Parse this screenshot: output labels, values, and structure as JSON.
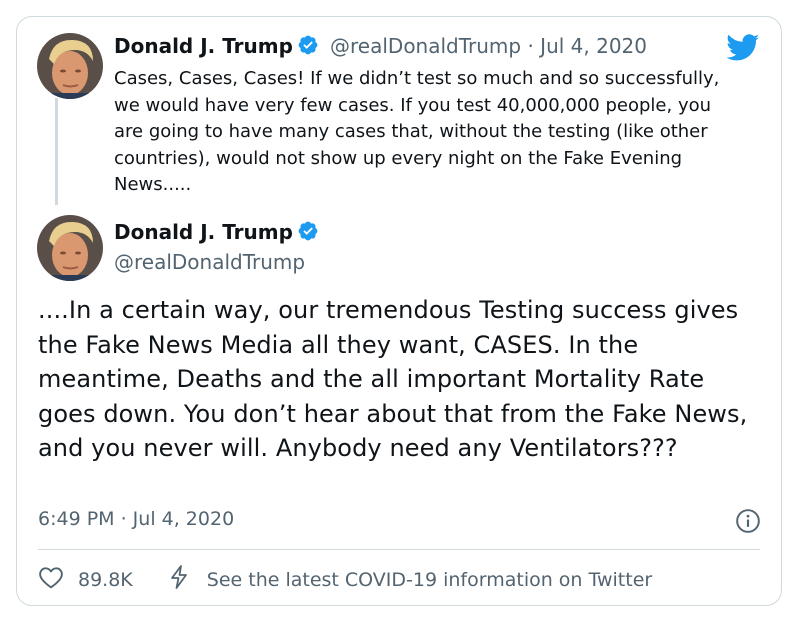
{
  "quoted_tweet": {
    "display_name": "Donald J. Trump",
    "handle": "@realDonaldTrump",
    "separator": " · ",
    "date": "Jul 4, 2020",
    "text": "Cases, Cases, Cases! If we didn’t test so much and so successfully, we would have very few cases. If you test 40,000,000 people, you are going to have many cases that, without the testing (like other countries), would not show up every night on the Fake Evening News....."
  },
  "main_tweet": {
    "display_name": "Donald J. Trump",
    "handle": "@realDonaldTrump",
    "text": "....In a certain way, our tremendous Testing success gives the Fake News Media all they want, CASES. In the meantime, Deaths and the all important Mortality Rate goes down. You don’t hear about that from the Fake News, and you never will. Anybody need any Ventilators???",
    "timestamp": "6:49 PM · Jul 4, 2020"
  },
  "footer": {
    "likes": "89.8K",
    "covid_link": "See the latest COVID-19 information on Twitter"
  },
  "icons": {
    "verified": "verified-badge-icon",
    "brand": "twitter-bird-icon",
    "info": "info-icon",
    "like": "heart-icon",
    "covid": "lightning-bolt-icon"
  },
  "colors": {
    "brand_blue": "#1d9bf0",
    "text": "#0f1419",
    "secondary_text": "#536471",
    "border": "#cfd9de"
  }
}
